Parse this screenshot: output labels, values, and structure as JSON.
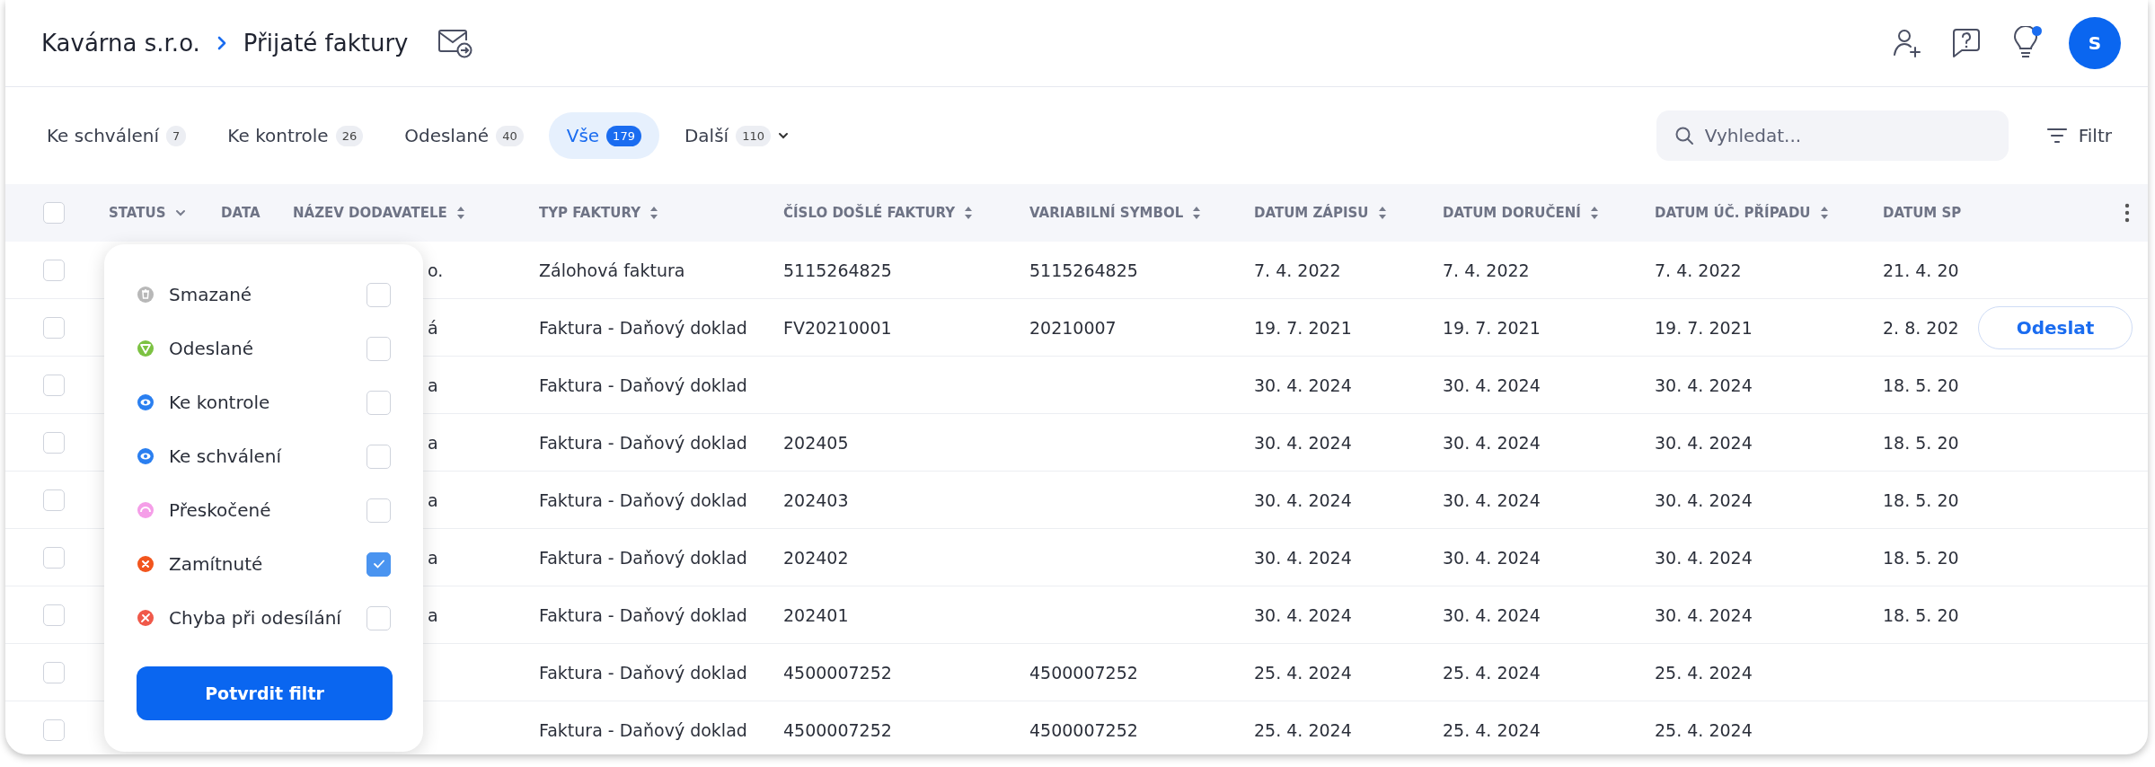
{
  "breadcrumb": {
    "company": "Kavárna s.r.o.",
    "page": "Přijaté faktury"
  },
  "avatar": {
    "initial": "S"
  },
  "notifications": {
    "unread": true
  },
  "tabs": [
    {
      "label": "Ke schválení",
      "count": "7",
      "selected": false,
      "kind": "tab"
    },
    {
      "label": "Ke kontrole",
      "count": "26",
      "selected": false,
      "kind": "tab"
    },
    {
      "label": "Odeslané",
      "count": "40",
      "selected": false,
      "kind": "tab"
    },
    {
      "label": "Vše",
      "count": "179",
      "selected": true,
      "kind": "tab"
    },
    {
      "label": "Další",
      "count": "110",
      "selected": false,
      "kind": "menu"
    }
  ],
  "search": {
    "placeholder": "Vyhledat..."
  },
  "filter_button": "Filtr",
  "table": {
    "all_checked": false,
    "columns": [
      {
        "label": "STATUS",
        "kind": "dropdown"
      },
      {
        "label": "DATA",
        "kind": "plain"
      },
      {
        "label": "NÁZEV DODAVATELE",
        "kind": "sort"
      },
      {
        "label": "TYP FAKTURY",
        "kind": "sort"
      },
      {
        "label": "ČÍSLO DOŠLÉ FAKTURY",
        "kind": "sort"
      },
      {
        "label": "VARIABILNÍ SYMBOL",
        "kind": "sort"
      },
      {
        "label": "DATUM ZÁPISU",
        "kind": "sort"
      },
      {
        "label": "DATUM DORUČENÍ",
        "kind": "sort"
      },
      {
        "label": "DATUM ÚČ. PŘÍPADU",
        "kind": "sort"
      },
      {
        "label": "DATUM SP",
        "kind": "plain"
      }
    ],
    "rows": [
      {
        "checked": false,
        "supplier": "o.",
        "type": "Zálohová faktura",
        "number": "5115264825",
        "vs": "5115264825",
        "entry": "7. 4. 2022",
        "delivery": "7. 4. 2022",
        "accounting": "7. 4. 2022",
        "due": "21. 4. 20",
        "action": ""
      },
      {
        "checked": false,
        "supplier": "á",
        "type": "Faktura - Daňový doklad",
        "number": "FV20210001",
        "vs": "20210007",
        "entry": "19. 7. 2021",
        "delivery": "19. 7. 2021",
        "accounting": "19. 7. 2021",
        "due": "2. 8. 202",
        "action": "Odeslat"
      },
      {
        "checked": false,
        "supplier": "a",
        "type": "Faktura - Daňový doklad",
        "number": "",
        "vs": "",
        "entry": "30. 4. 2024",
        "delivery": "30. 4. 2024",
        "accounting": "30. 4. 2024",
        "due": "18. 5. 20",
        "action": ""
      },
      {
        "checked": false,
        "supplier": "a",
        "type": "Faktura - Daňový doklad",
        "number": "202405",
        "vs": "",
        "entry": "30. 4. 2024",
        "delivery": "30. 4. 2024",
        "accounting": "30. 4. 2024",
        "due": "18. 5. 20",
        "action": ""
      },
      {
        "checked": false,
        "supplier": "a",
        "type": "Faktura - Daňový doklad",
        "number": "202403",
        "vs": "",
        "entry": "30. 4. 2024",
        "delivery": "30. 4. 2024",
        "accounting": "30. 4. 2024",
        "due": "18. 5. 20",
        "action": ""
      },
      {
        "checked": false,
        "supplier": "a",
        "type": "Faktura - Daňový doklad",
        "number": "202402",
        "vs": "",
        "entry": "30. 4. 2024",
        "delivery": "30. 4. 2024",
        "accounting": "30. 4. 2024",
        "due": "18. 5. 20",
        "action": ""
      },
      {
        "checked": false,
        "supplier": "a",
        "type": "Faktura - Daňový doklad",
        "number": "202401",
        "vs": "",
        "entry": "30. 4. 2024",
        "delivery": "30. 4. 2024",
        "accounting": "30. 4. 2024",
        "due": "18. 5. 20",
        "action": ""
      },
      {
        "checked": false,
        "supplier": "",
        "type": "Faktura - Daňový doklad",
        "number": "4500007252",
        "vs": "4500007252",
        "entry": "25. 4. 2024",
        "delivery": "25. 4. 2024",
        "accounting": "25. 4. 2024",
        "due": "",
        "action": ""
      },
      {
        "checked": false,
        "supplier": "",
        "type": "Faktura - Daňový doklad",
        "number": "4500007252",
        "vs": "4500007252",
        "entry": "25. 4. 2024",
        "delivery": "25. 4. 2024",
        "accounting": "25. 4. 2024",
        "due": "",
        "action": ""
      }
    ]
  },
  "status_filter": {
    "items": [
      {
        "label": "Smazané",
        "kind": "trash",
        "color": "#b8b8b8",
        "checked": false
      },
      {
        "label": "Odeslané",
        "kind": "send",
        "color": "#7cc242",
        "checked": false
      },
      {
        "label": "Ke kontrole",
        "kind": "eye",
        "color": "#2a7ff0",
        "checked": false
      },
      {
        "label": "Ke schválení",
        "kind": "eye",
        "color": "#2a7ff0",
        "checked": false
      },
      {
        "label": "Přeskočené",
        "kind": "skip",
        "color": "#f59ee8",
        "checked": false
      },
      {
        "label": "Zamítnuté",
        "kind": "cross",
        "color": "#f2551d",
        "checked": true
      },
      {
        "label": "Chyba při odesílání",
        "kind": "error",
        "color": "#f0594a",
        "checked": false
      }
    ],
    "confirm": "Potvrdit filtr"
  }
}
